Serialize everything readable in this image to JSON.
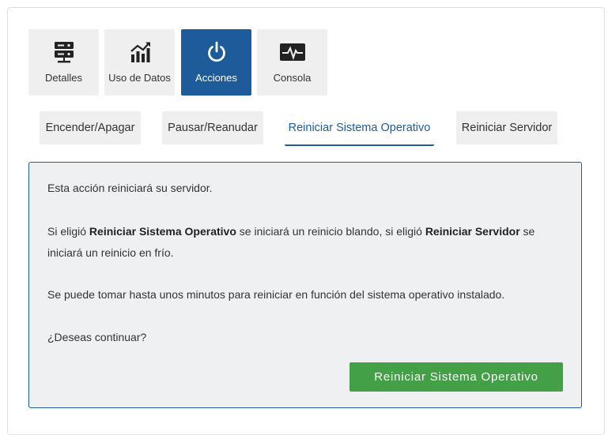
{
  "icon_tabs": [
    {
      "label": "Detalles",
      "icon": "server-icon"
    },
    {
      "label": "Uso de Datos",
      "icon": "chart-icon"
    },
    {
      "label": "Acciones",
      "icon": "power-icon",
      "active": true
    },
    {
      "label": "Consola",
      "icon": "pulse-monitor-icon"
    }
  ],
  "action_tabs": [
    {
      "label": "Encender/Apagar"
    },
    {
      "label": "Pausar/Reanudar"
    },
    {
      "label": "Reiniciar Sistema Operativo",
      "active": true
    },
    {
      "label": "Reiniciar Servidor"
    }
  ],
  "panel": {
    "line1": "Esta acción reiniciará su servidor.",
    "line2_a": "Si eligió ",
    "line2_b": "Reiniciar Sistema Operativo",
    "line2_c": " se iniciará un reinicio blando, si eligió ",
    "line2_d": "Reiniciar Servidor",
    "line2_e": " se iniciará un reinicio en frío.",
    "line3": "Se puede tomar hasta unos minutos para reiniciar en función del sistema operativo instalado.",
    "line4": "¿Deseas continuar?",
    "confirm_button": "Reiniciar Sistema Operativo"
  },
  "colors": {
    "accent": "#1d5b9a",
    "confirm": "#43a047",
    "panel_bg": "#eef0f2",
    "tab_bg": "#efefef"
  }
}
